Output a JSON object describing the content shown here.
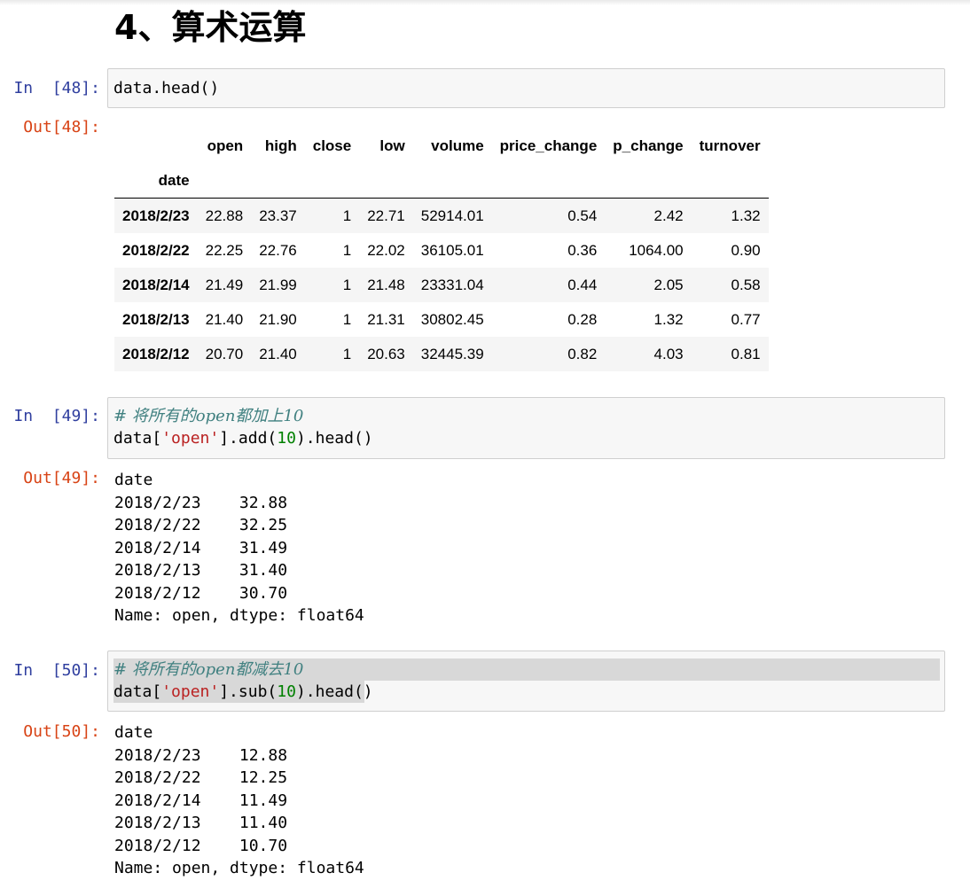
{
  "heading": "4、算术运算",
  "cells": [
    {
      "in_prompt": "In  [48]:",
      "code_line1": "data.head()",
      "out_prompt": "Out[48]:",
      "table": {
        "columns": [
          "open",
          "high",
          "close",
          "low",
          "volume",
          "price_change",
          "p_change",
          "turnover"
        ],
        "index_name": "date",
        "rows": [
          {
            "date": "2018/2/23",
            "values": [
              "22.88",
              "23.37",
              "1",
              "22.71",
              "52914.01",
              "0.54",
              "2.42",
              "1.32"
            ]
          },
          {
            "date": "2018/2/22",
            "values": [
              "22.25",
              "22.76",
              "1",
              "22.02",
              "36105.01",
              "0.36",
              "1064.00",
              "0.90"
            ]
          },
          {
            "date": "2018/2/14",
            "values": [
              "21.49",
              "21.99",
              "1",
              "21.48",
              "23331.04",
              "0.44",
              "2.05",
              "0.58"
            ]
          },
          {
            "date": "2018/2/13",
            "values": [
              "21.40",
              "21.90",
              "1",
              "21.31",
              "30802.45",
              "0.28",
              "1.32",
              "0.77"
            ]
          },
          {
            "date": "2018/2/12",
            "values": [
              "20.70",
              "21.40",
              "1",
              "20.63",
              "32445.39",
              "0.82",
              "4.03",
              "0.81"
            ]
          }
        ]
      }
    },
    {
      "in_prompt": "In  [49]:",
      "comment": "# 将所有的open都加上10",
      "code_prefix": "data[",
      "code_string": "'open'",
      "code_mid": "].add(",
      "code_number": "10",
      "code_suffix": ").head()",
      "out_prompt": "Out[49]:",
      "output": "date\n2018/2/23    32.88\n2018/2/22    32.25\n2018/2/14    31.49\n2018/2/13    31.40\n2018/2/12    30.70\nName: open, dtype: float64"
    },
    {
      "in_prompt": "In  [50]:",
      "comment": "# 将所有的open都减去10",
      "code_prefix": "data[",
      "code_string": "'open'",
      "code_mid": "].sub(",
      "code_number": "10",
      "code_suffix": ").head()",
      "out_prompt": "Out[50]:",
      "output": "date\n2018/2/23    12.88\n2018/2/22    12.25\n2018/2/14    11.49\n2018/2/13    11.40\n2018/2/12    10.70\nName: open, dtype: float64"
    }
  ]
}
